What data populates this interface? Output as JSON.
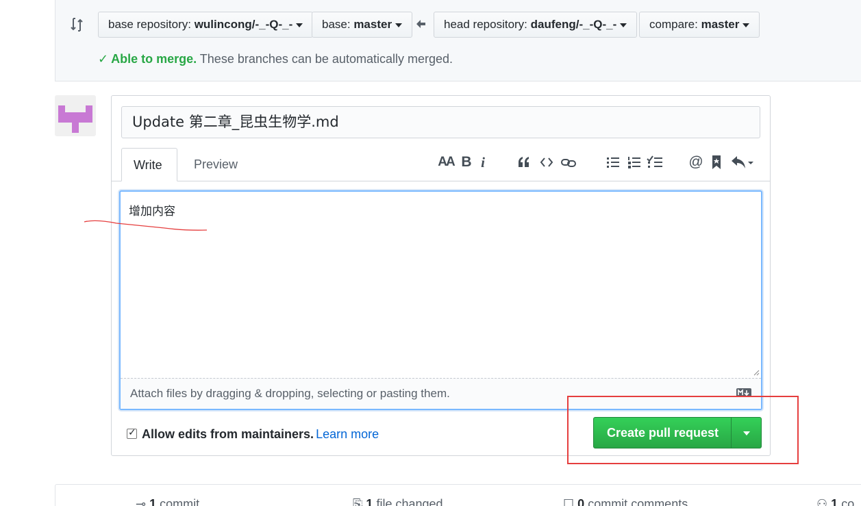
{
  "compare": {
    "base_repo_prefix": "base repository: ",
    "base_repo": "wulincong/-_-Q-_-",
    "base_prefix": "base: ",
    "base": "master",
    "head_repo_prefix": "head repository: ",
    "head_repo": "daufeng/-_-Q-_-",
    "compare_prefix": "compare: ",
    "compare": "master",
    "merge_status_strong": "Able to merge.",
    "merge_status_text": " These branches can be automatically merged."
  },
  "form": {
    "title_value": "Update 第二章_昆虫生物学.md",
    "tabs": {
      "write": "Write",
      "preview": "Preview"
    },
    "toolbar": {
      "heading": "AA",
      "bold": "B",
      "italic": "i",
      "at": "@"
    },
    "body_value": "增加内容",
    "drop_hint": "Attach files by dragging & dropping, selecting or pasting them.",
    "maintainer_label": "Allow edits from maintainers.",
    "learn_more": "Learn more",
    "create_button": "Create pull request"
  },
  "stats": {
    "commits_count": "1",
    "commits_label": "commit",
    "files_count": "1",
    "files_label": "file changed",
    "comments_count": "0",
    "comments_label": "commit comments",
    "contributors_count": "1",
    "contributors_label": "co"
  },
  "colors": {
    "success": "#28a745",
    "link": "#0366d6",
    "annotation": "#e53e3e"
  }
}
